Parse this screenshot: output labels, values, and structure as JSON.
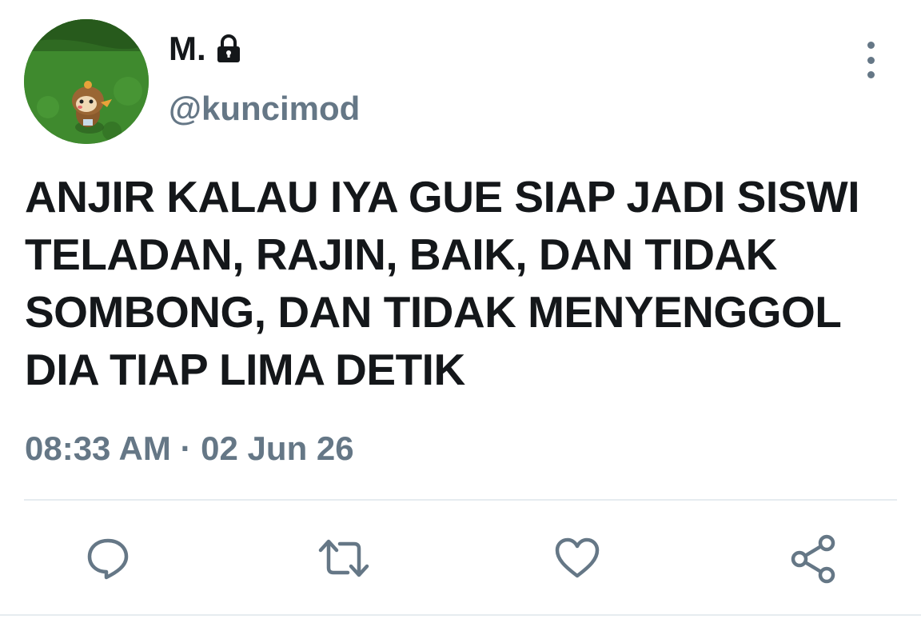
{
  "user": {
    "display_name": "M.",
    "handle": "@kuncimod",
    "protected": true,
    "avatar_icon": "pokemon-chimchar-avatar"
  },
  "tweet": {
    "text": "ANJIR KALAU IYA GUE SIAP JADI SISWI TELADAN, RAJIN, BAIK, DAN TIDAK SOMBONG, DAN TIDAK MENYENGGOL DIA TIAP LIMA DETIK",
    "timestamp": "08:33 AM · 02 Jun 26"
  },
  "actions": [
    {
      "name": "reply",
      "icon": "comment-icon"
    },
    {
      "name": "retweet",
      "icon": "retweet-icon"
    },
    {
      "name": "like",
      "icon": "heart-icon"
    },
    {
      "name": "share",
      "icon": "share-icon"
    }
  ],
  "colors": {
    "text_primary": "#14171a",
    "text_secondary": "#657786",
    "divider": "#e6ecf0"
  }
}
